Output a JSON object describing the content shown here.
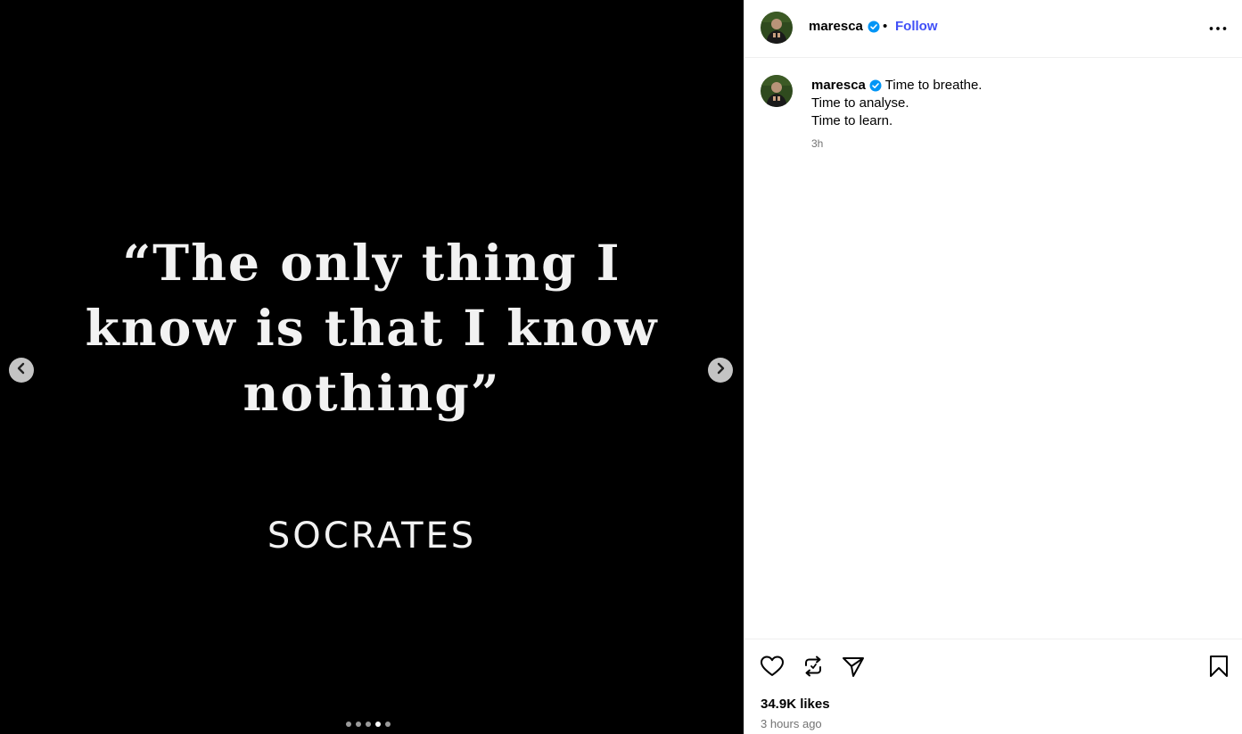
{
  "post": {
    "media": {
      "quote_lines": [
        "“The only thing I",
        "know is that I know",
        "nothing”"
      ],
      "author": "SOCRATES",
      "carousel": {
        "total": 5,
        "active_index": 3
      },
      "prev_icon": "chevron-left-icon",
      "next_icon": "chevron-right-icon"
    },
    "header": {
      "username": "maresca",
      "verified": true,
      "separator": "•",
      "follow_label": "Follow",
      "more_icon": "more-horizontal-icon"
    },
    "caption": {
      "username": "maresca",
      "lines": [
        "Time to breathe.",
        "Time to analyse.",
        "Time to learn."
      ],
      "time_ago": "3h"
    },
    "actions": {
      "like_icon": "heart-icon",
      "repost_icon": "repost-icon",
      "share_icon": "send-icon",
      "save_icon": "bookmark-icon",
      "likes_text": "34.9K likes",
      "posted_text": "3 hours ago"
    },
    "colors": {
      "follow": "#4150f7",
      "verified": "#0095f6",
      "muted": "#737373",
      "media_bg": "#000000"
    }
  }
}
